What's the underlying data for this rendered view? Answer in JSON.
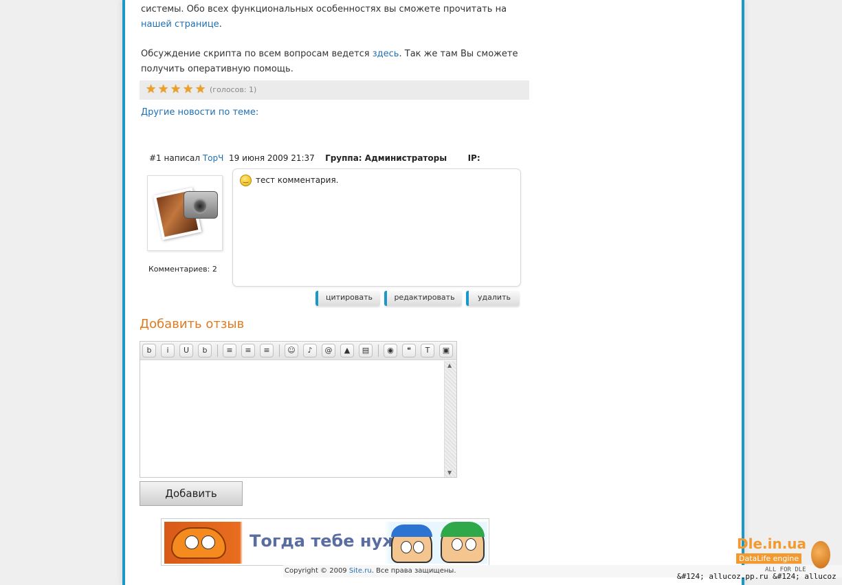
{
  "article": {
    "p1_text": "системы. Обо всех функциональных особенностях вы сможете прочитать на ",
    "p1_link": "нашей странице",
    "p1_end": ".",
    "p2_text": "Обсуждение скрипта по всем вопросам ведется ",
    "p2_link": "здесь",
    "p2_end": ". Так же там Вы сможете получить оперативную помощь."
  },
  "rating": {
    "stars_filled": 5,
    "stars_total": 5,
    "votes_label": "(голосов: 1)"
  },
  "related_news_label": "Другие новости по теме:",
  "comment": {
    "number": "#1",
    "wrote_label": "написал",
    "author": "ТорЧ",
    "date": "19 июня 2009 21:37",
    "group_label": "Группа: Администраторы",
    "ip_label": "IP:",
    "text": "тест комментария.",
    "comments_count_label": "Комментариев: 2",
    "actions": {
      "quote": "цитировать",
      "edit": "редактировать",
      "delete": "удалить"
    }
  },
  "add_review": {
    "title": "Добавить отзыв",
    "toolbar": [
      {
        "icon": "bold-icon",
        "glyph": "b"
      },
      {
        "icon": "italic-icon",
        "glyph": "i"
      },
      {
        "icon": "underline-icon",
        "glyph": "U"
      },
      {
        "icon": "strike-icon",
        "glyph": "b"
      },
      {
        "icon": "align-left-icon",
        "glyph": "≡"
      },
      {
        "icon": "align-center-icon",
        "glyph": "≡"
      },
      {
        "icon": "align-right-icon",
        "glyph": "≡"
      },
      {
        "icon": "smiley-icon",
        "glyph": "☺"
      },
      {
        "icon": "link-icon",
        "glyph": "♪"
      },
      {
        "icon": "email-icon",
        "glyph": "@"
      },
      {
        "icon": "image-icon",
        "glyph": "▲"
      },
      {
        "icon": "color-icon",
        "glyph": "▤"
      },
      {
        "icon": "hide-icon",
        "glyph": "◉"
      },
      {
        "icon": "quote-icon",
        "glyph": "❝"
      },
      {
        "icon": "translit-icon",
        "glyph": "T"
      },
      {
        "icon": "code-icon",
        "glyph": "▣"
      }
    ],
    "textarea_value": "",
    "submit_label": "Добавить"
  },
  "banner": {
    "text": "Тогда тебе нужен"
  },
  "footer": {
    "prefix": "Copyright © 2009 ",
    "site_link": "Site.ru",
    "suffix": ". Все права защищены."
  },
  "watermark": {
    "text": "&#124; allucoz.pp.ru &#124; allucoz",
    "logo_title": "Dle.in.ua",
    "logo_sub": "DataLife engine",
    "logo_tagline": "ALL FOR DLE"
  },
  "colors": {
    "frame": "#1a98c8",
    "link": "#1f6fb4",
    "accent": "#e07a1f"
  }
}
